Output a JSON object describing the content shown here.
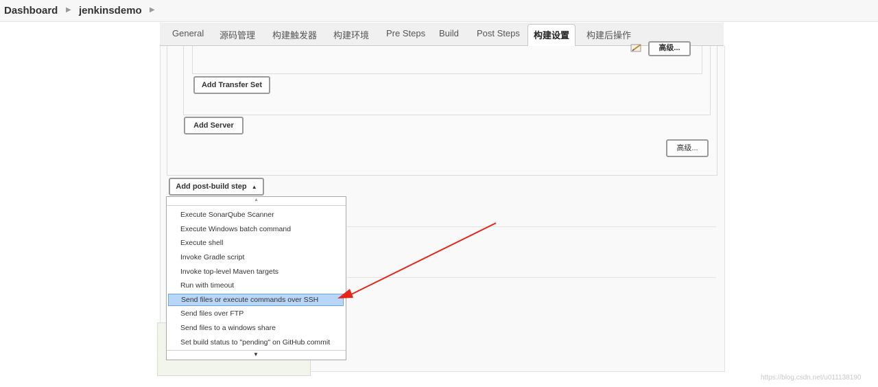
{
  "breadcrumb": {
    "items": [
      "Dashboard",
      "jenkinsdemo"
    ]
  },
  "tabs": [
    "General",
    "源码管理",
    "构建触发器",
    "构建环境",
    "Pre Steps",
    "Build",
    "Post Steps",
    "构建设置",
    "构建后操作"
  ],
  "active_tab": "构建设置",
  "buttons": {
    "advanced_top": "高级...",
    "add_transfer_set": "Add Transfer Set",
    "add_server": "Add Server",
    "advanced": "高级...",
    "add_post_build_step": "Add post-build step"
  },
  "dropdown": {
    "items": [
      "Execute SonarQube Scanner",
      "Execute Windows batch command",
      "Execute shell",
      "Invoke Gradle script",
      "Invoke top-level Maven targets",
      "Run with timeout",
      "Send files or execute commands over SSH",
      "Send files over FTP",
      "Send files to a windows share",
      "Set build status to \"pending\" on GitHub commit"
    ],
    "selected_item": "Send files or execute commands over SSH"
  },
  "annotation_arrow_color": "#e8241a",
  "watermark": "https://blog.csdn.net/u011138190"
}
